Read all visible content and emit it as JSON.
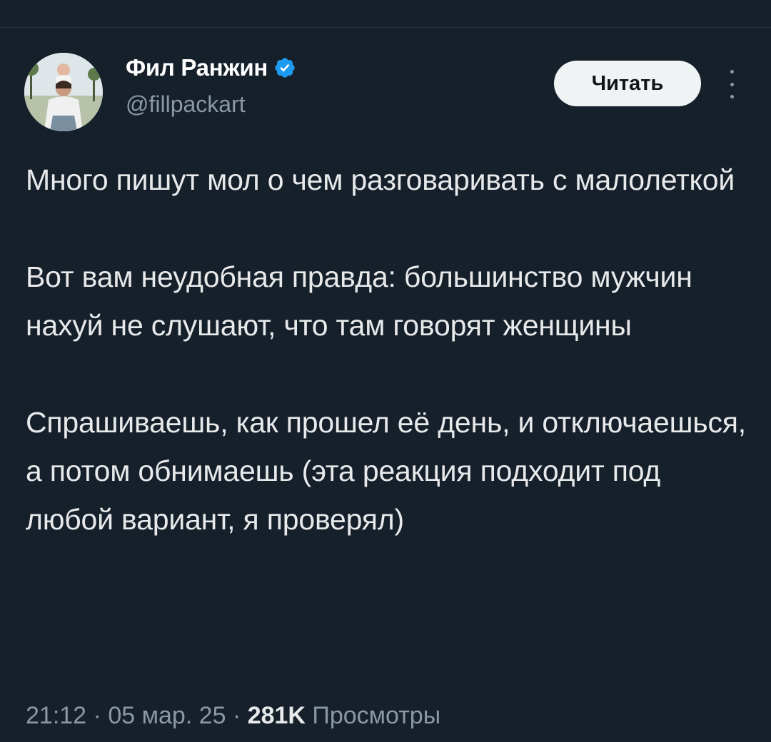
{
  "author": {
    "display_name": "Фил Ранжин",
    "handle": "@fillpackart",
    "verified": true
  },
  "follow_button": {
    "label": "Читать"
  },
  "more_menu": {
    "icon": "more-vertical-icon"
  },
  "tweet": {
    "paragraphs": [
      "Много пишут мол о чем разговаривать с малолеткой",
      "Вот вам неудобная правда: большинство мужчин нахуй не слушают, что там говорят женщины",
      "Спрашиваешь, как прошел её день, и отключаешься, а потом обнимаешь (эта реакция подходит под любой вариант, я проверял)"
    ]
  },
  "meta": {
    "time": "21:12",
    "separator": " · ",
    "date": "05 мар. 25",
    "views_count": "281K",
    "views_label": " Просмотры"
  },
  "colors": {
    "background": "#15202b",
    "text": "#e7e9ea",
    "secondary_text": "#8b98a5",
    "verified_badge": "#1d9bf0",
    "button_bg": "#eff3f4"
  }
}
